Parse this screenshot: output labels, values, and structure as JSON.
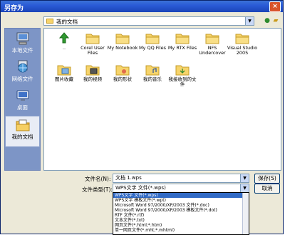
{
  "window": {
    "title": "另存为",
    "close_glyph": "×"
  },
  "toolbar": {
    "path": "我的文档"
  },
  "places": [
    {
      "label": "本地文件",
      "icon": "computer-icon"
    },
    {
      "label": "网络文件",
      "icon": "network-icon"
    },
    {
      "label": "桌面",
      "icon": "desktop-icon"
    },
    {
      "label": "我的文档",
      "icon": "documents-icon",
      "active": true
    }
  ],
  "files": [
    {
      "label": "..",
      "icon": "up-folder-icon"
    },
    {
      "label": "Corel User Files",
      "icon": "folder-icon"
    },
    {
      "label": "My Notebook",
      "icon": "folder-icon"
    },
    {
      "label": "My QQ Files",
      "icon": "folder-icon"
    },
    {
      "label": "My RTX Files",
      "icon": "folder-icon"
    },
    {
      "label": "NFS Undercover",
      "icon": "folder-icon"
    },
    {
      "label": "Visual Studio 2005",
      "icon": "folder-icon"
    },
    {
      "label": "图片收藏",
      "icon": "pictures-folder-icon"
    },
    {
      "label": "我的视频",
      "icon": "videos-folder-icon"
    },
    {
      "label": "我的形状",
      "icon": "shapes-folder-icon"
    },
    {
      "label": "我的音乐",
      "icon": "music-folder-icon"
    },
    {
      "label": "我接收到的文件",
      "icon": "received-folder-icon"
    }
  ],
  "form": {
    "filename_label": "文件名(N):",
    "filename_value": "文档 1.wps",
    "filetype_label": "文件类型(T):",
    "filetype_value": "WPS文字 文件(*.wps)",
    "save_label": "保存(S)",
    "cancel_label": "取消"
  },
  "filetype_options": [
    "WPS文字 文件(*.wps)",
    "WPS文字 模板文件(*.wpt)",
    "Microsoft Word 97/2000/XP/2003 文件(*.doc)",
    "Microsoft Word 97/2000/XP/2003 模板文件(*.dot)",
    "RTF 文件(*.rtf)",
    "文本文件(*.txt)",
    "网页文件(*.html;*.htm)",
    "单一网页文件(*.mht;*.mhtml)"
  ]
}
